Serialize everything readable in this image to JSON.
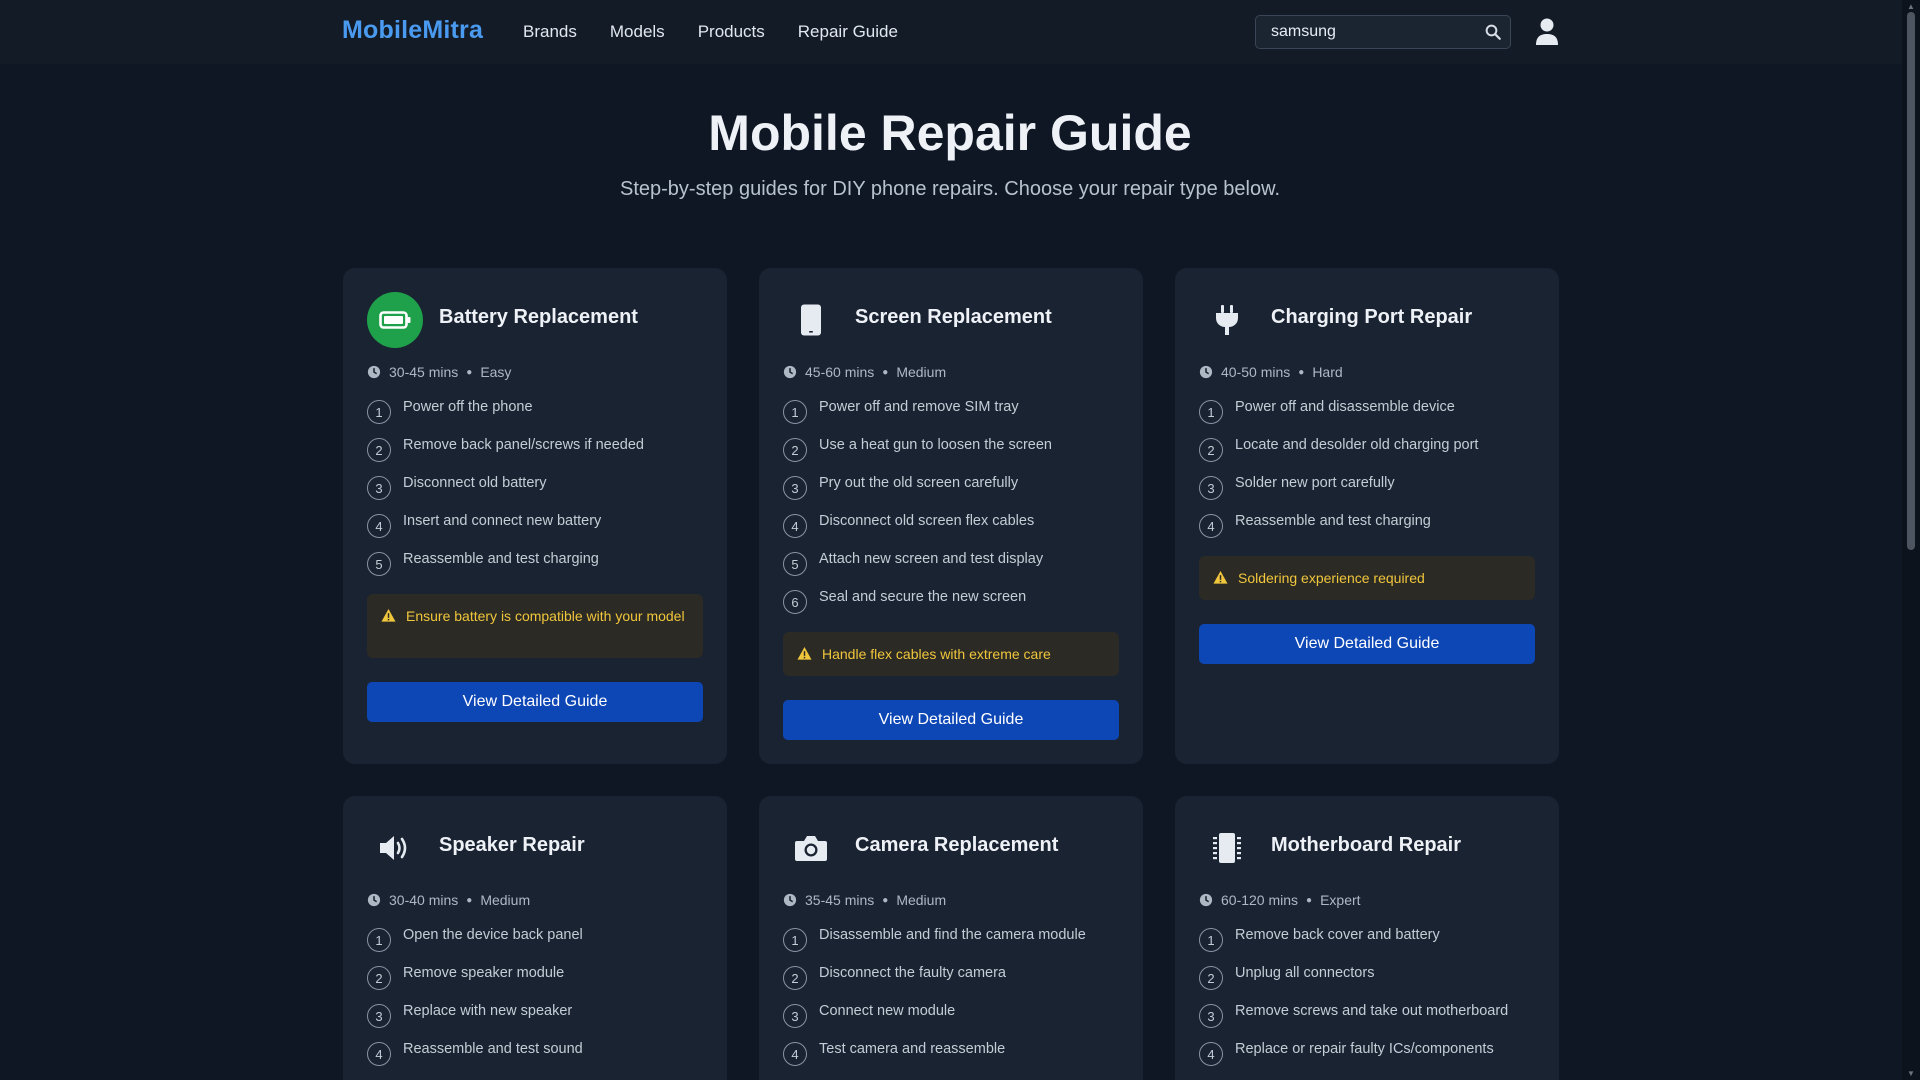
{
  "nav": {
    "logo": "MobileMitra",
    "links": [
      "Brands",
      "Models",
      "Products",
      "Repair Guide"
    ],
    "search_value": "samsung"
  },
  "hero": {
    "title": "Mobile Repair Guide",
    "subtitle": "Step-by-step guides for DIY phone repairs. Choose your repair type below."
  },
  "cards": [
    {
      "title": "Battery Replacement",
      "icon": "battery-icon",
      "time": "30-45 mins",
      "difficulty": "Easy",
      "steps": [
        "Power off the phone",
        "Remove back panel/screws if needed",
        "Disconnect old battery",
        "Insert and connect new battery",
        "Reassemble and test charging"
      ],
      "warning": "Ensure battery is compatible with your model",
      "button": "View Detailed Guide"
    },
    {
      "title": "Screen Replacement",
      "icon": "phone-icon",
      "time": "45-60 mins",
      "difficulty": "Medium",
      "steps": [
        "Power off and remove SIM tray",
        "Use a heat gun to loosen the screen",
        "Pry out the old screen carefully",
        "Disconnect old screen flex cables",
        "Attach new screen and test display",
        "Seal and secure the new screen"
      ],
      "warning": "Handle flex cables with extreme care",
      "button": "View Detailed Guide"
    },
    {
      "title": "Charging Port Repair",
      "icon": "plug-icon",
      "time": "40-50 mins",
      "difficulty": "Hard",
      "steps": [
        "Power off and disassemble device",
        "Locate and desolder old charging port",
        "Solder new port carefully",
        "Reassemble and test charging"
      ],
      "warning": "Soldering experience required",
      "button": "View Detailed Guide"
    },
    {
      "title": "Speaker Repair",
      "icon": "speaker-icon",
      "time": "30-40 mins",
      "difficulty": "Medium",
      "steps": [
        "Open the device back panel",
        "Remove speaker module",
        "Replace with new speaker",
        "Reassemble and test sound"
      ]
    },
    {
      "title": "Camera Replacement",
      "icon": "camera-icon",
      "time": "35-45 mins",
      "difficulty": "Medium",
      "steps": [
        "Disassemble and find the camera module",
        "Disconnect the faulty camera",
        "Connect new module",
        "Test camera and reassemble"
      ]
    },
    {
      "title": "Motherboard Repair",
      "icon": "chip-icon",
      "time": "60-120 mins",
      "difficulty": "Expert",
      "steps": [
        "Remove back cover and battery",
        "Unplug all connectors",
        "Remove screws and take out motherboard",
        "Replace or repair faulty ICs/components"
      ]
    }
  ],
  "colors": {
    "background": "#0f1724",
    "card": "#1a2332",
    "accent": "#4a9af0",
    "button": "#0d46b5",
    "battery_icon_bg": "#1fa04a",
    "warning_text": "#f0c63c"
  }
}
